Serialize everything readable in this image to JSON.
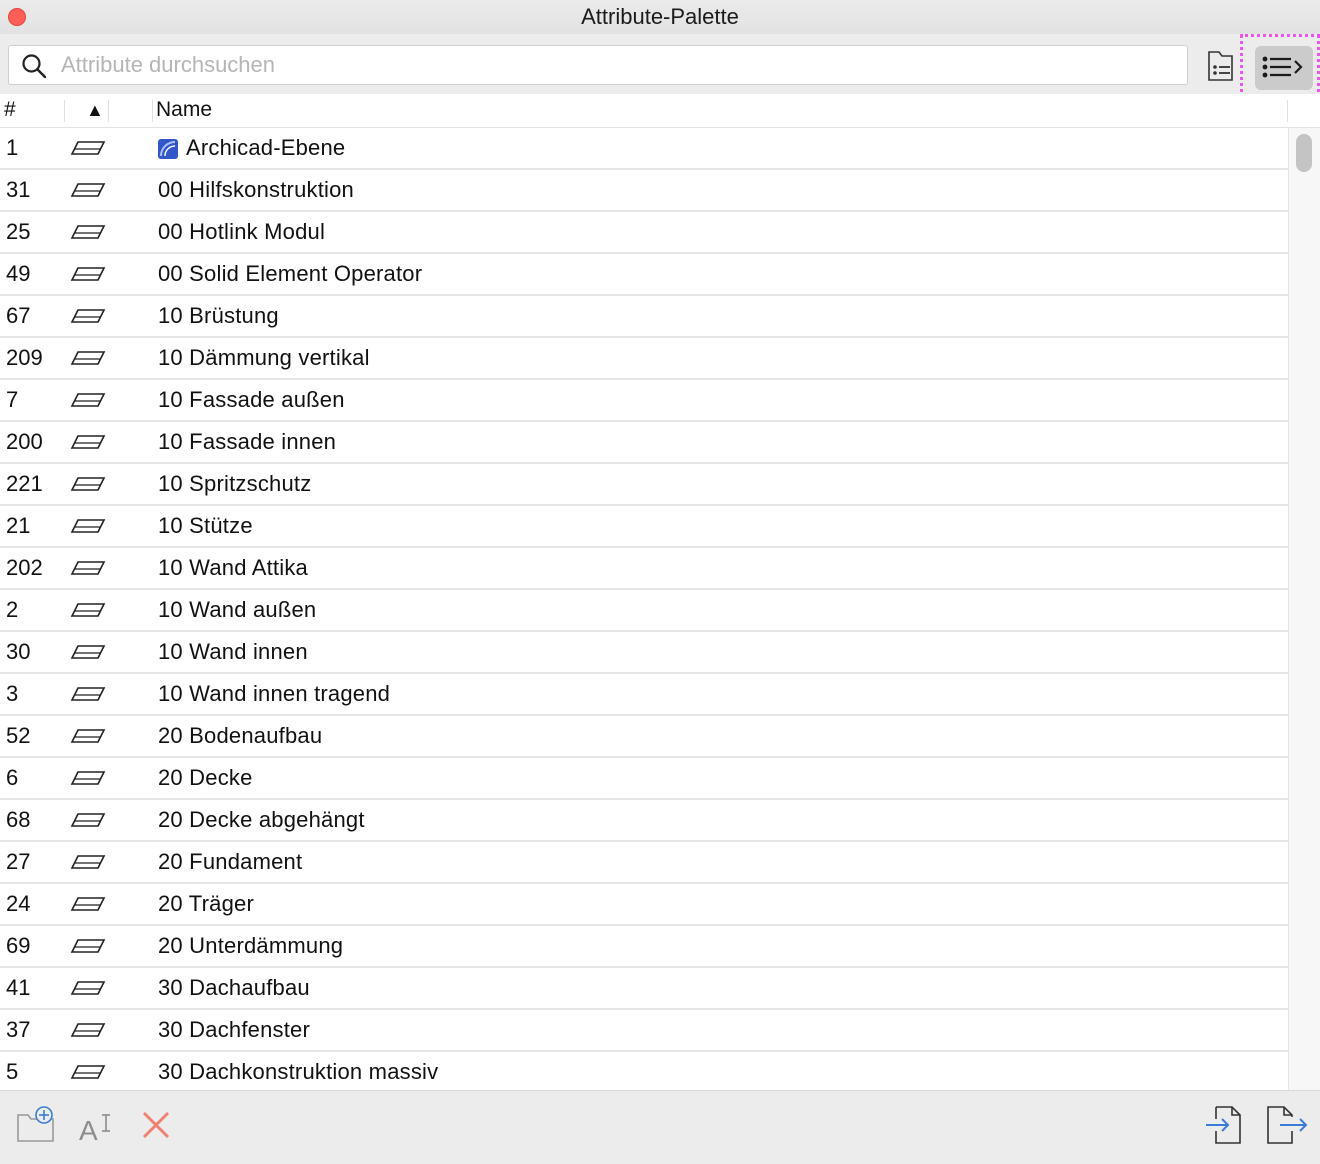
{
  "window": {
    "title": "Attribute-Palette"
  },
  "search": {
    "placeholder": "Attribute durchsuchen",
    "value": ""
  },
  "toolbar": {
    "folder_icon": "folder-list-icon",
    "list_icon": "list-view-icon"
  },
  "columns": {
    "number": "#",
    "sort_indicator": "▲",
    "name": "Name"
  },
  "rows": [
    {
      "num": "1",
      "name": "Archicad-Ebene"
    },
    {
      "num": "31",
      "name": "00 Hilfskonstruktion"
    },
    {
      "num": "25",
      "name": "00 Hotlink Modul"
    },
    {
      "num": "49",
      "name": "00 Solid Element Operator"
    },
    {
      "num": "67",
      "name": "10 Brüstung"
    },
    {
      "num": "209",
      "name": "10 Dämmung vertikal"
    },
    {
      "num": "7",
      "name": "10 Fassade außen"
    },
    {
      "num": "200",
      "name": "10 Fassade innen"
    },
    {
      "num": "221",
      "name": "10 Spritzschutz"
    },
    {
      "num": "21",
      "name": "10 Stütze"
    },
    {
      "num": "202",
      "name": "10 Wand Attika"
    },
    {
      "num": "2",
      "name": "10 Wand außen"
    },
    {
      "num": "30",
      "name": "10 Wand innen"
    },
    {
      "num": "3",
      "name": "10 Wand innen tragend"
    },
    {
      "num": "52",
      "name": "20 Bodenaufbau"
    },
    {
      "num": "6",
      "name": "20 Decke"
    },
    {
      "num": "68",
      "name": "20 Decke abgehängt"
    },
    {
      "num": "27",
      "name": "20 Fundament"
    },
    {
      "num": "24",
      "name": "20 Träger"
    },
    {
      "num": "69",
      "name": "20 Unterdämmung"
    },
    {
      "num": "41",
      "name": "30 Dachaufbau"
    },
    {
      "num": "37",
      "name": "30 Dachfenster"
    },
    {
      "num": "5",
      "name": "30 Dachkonstruktion massiv"
    }
  ],
  "colors": {
    "close": "#fd5f57",
    "highlight": "#ee55ee",
    "delete": "#f0806f",
    "import_export": "#3a7bd5"
  }
}
